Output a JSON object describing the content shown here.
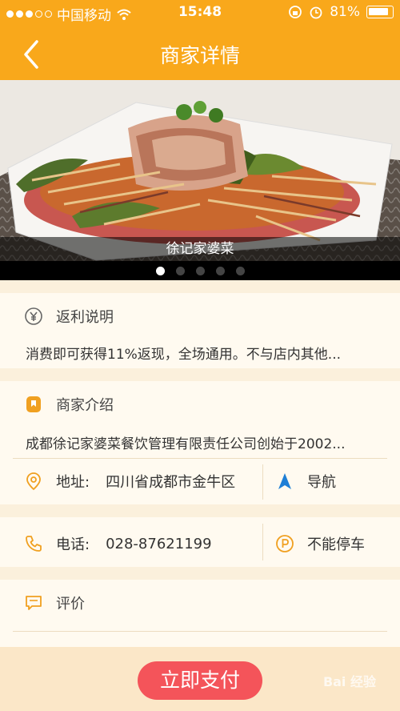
{
  "status_bar": {
    "carrier": "中国移动",
    "time": "15:48",
    "battery": "81%"
  },
  "nav": {
    "title": "商家详情"
  },
  "hero": {
    "caption": "徐记家婆菜",
    "slide_count": 5,
    "active_index": 0
  },
  "rebate": {
    "heading": "返利说明",
    "text": "消费即可获得11%返现，全场通用。不与店内其他..."
  },
  "intro": {
    "heading": "商家介绍",
    "text": "成都徐记家婆菜餐饮管理有限责任公司创始于2002..."
  },
  "address": {
    "label": "地址:",
    "value": "四川省成都市金牛区",
    "navigate_label": "导航"
  },
  "phone": {
    "label": "电话:",
    "value": "028-87621199",
    "parking": "不能停车"
  },
  "review": {
    "heading": "评价"
  },
  "footer": {
    "pay_label": "立即支付",
    "watermark": "Bai 经验"
  },
  "colors": {
    "brand": "#f9a81b",
    "pay": "#f4545a",
    "icon": "#f0a020"
  }
}
